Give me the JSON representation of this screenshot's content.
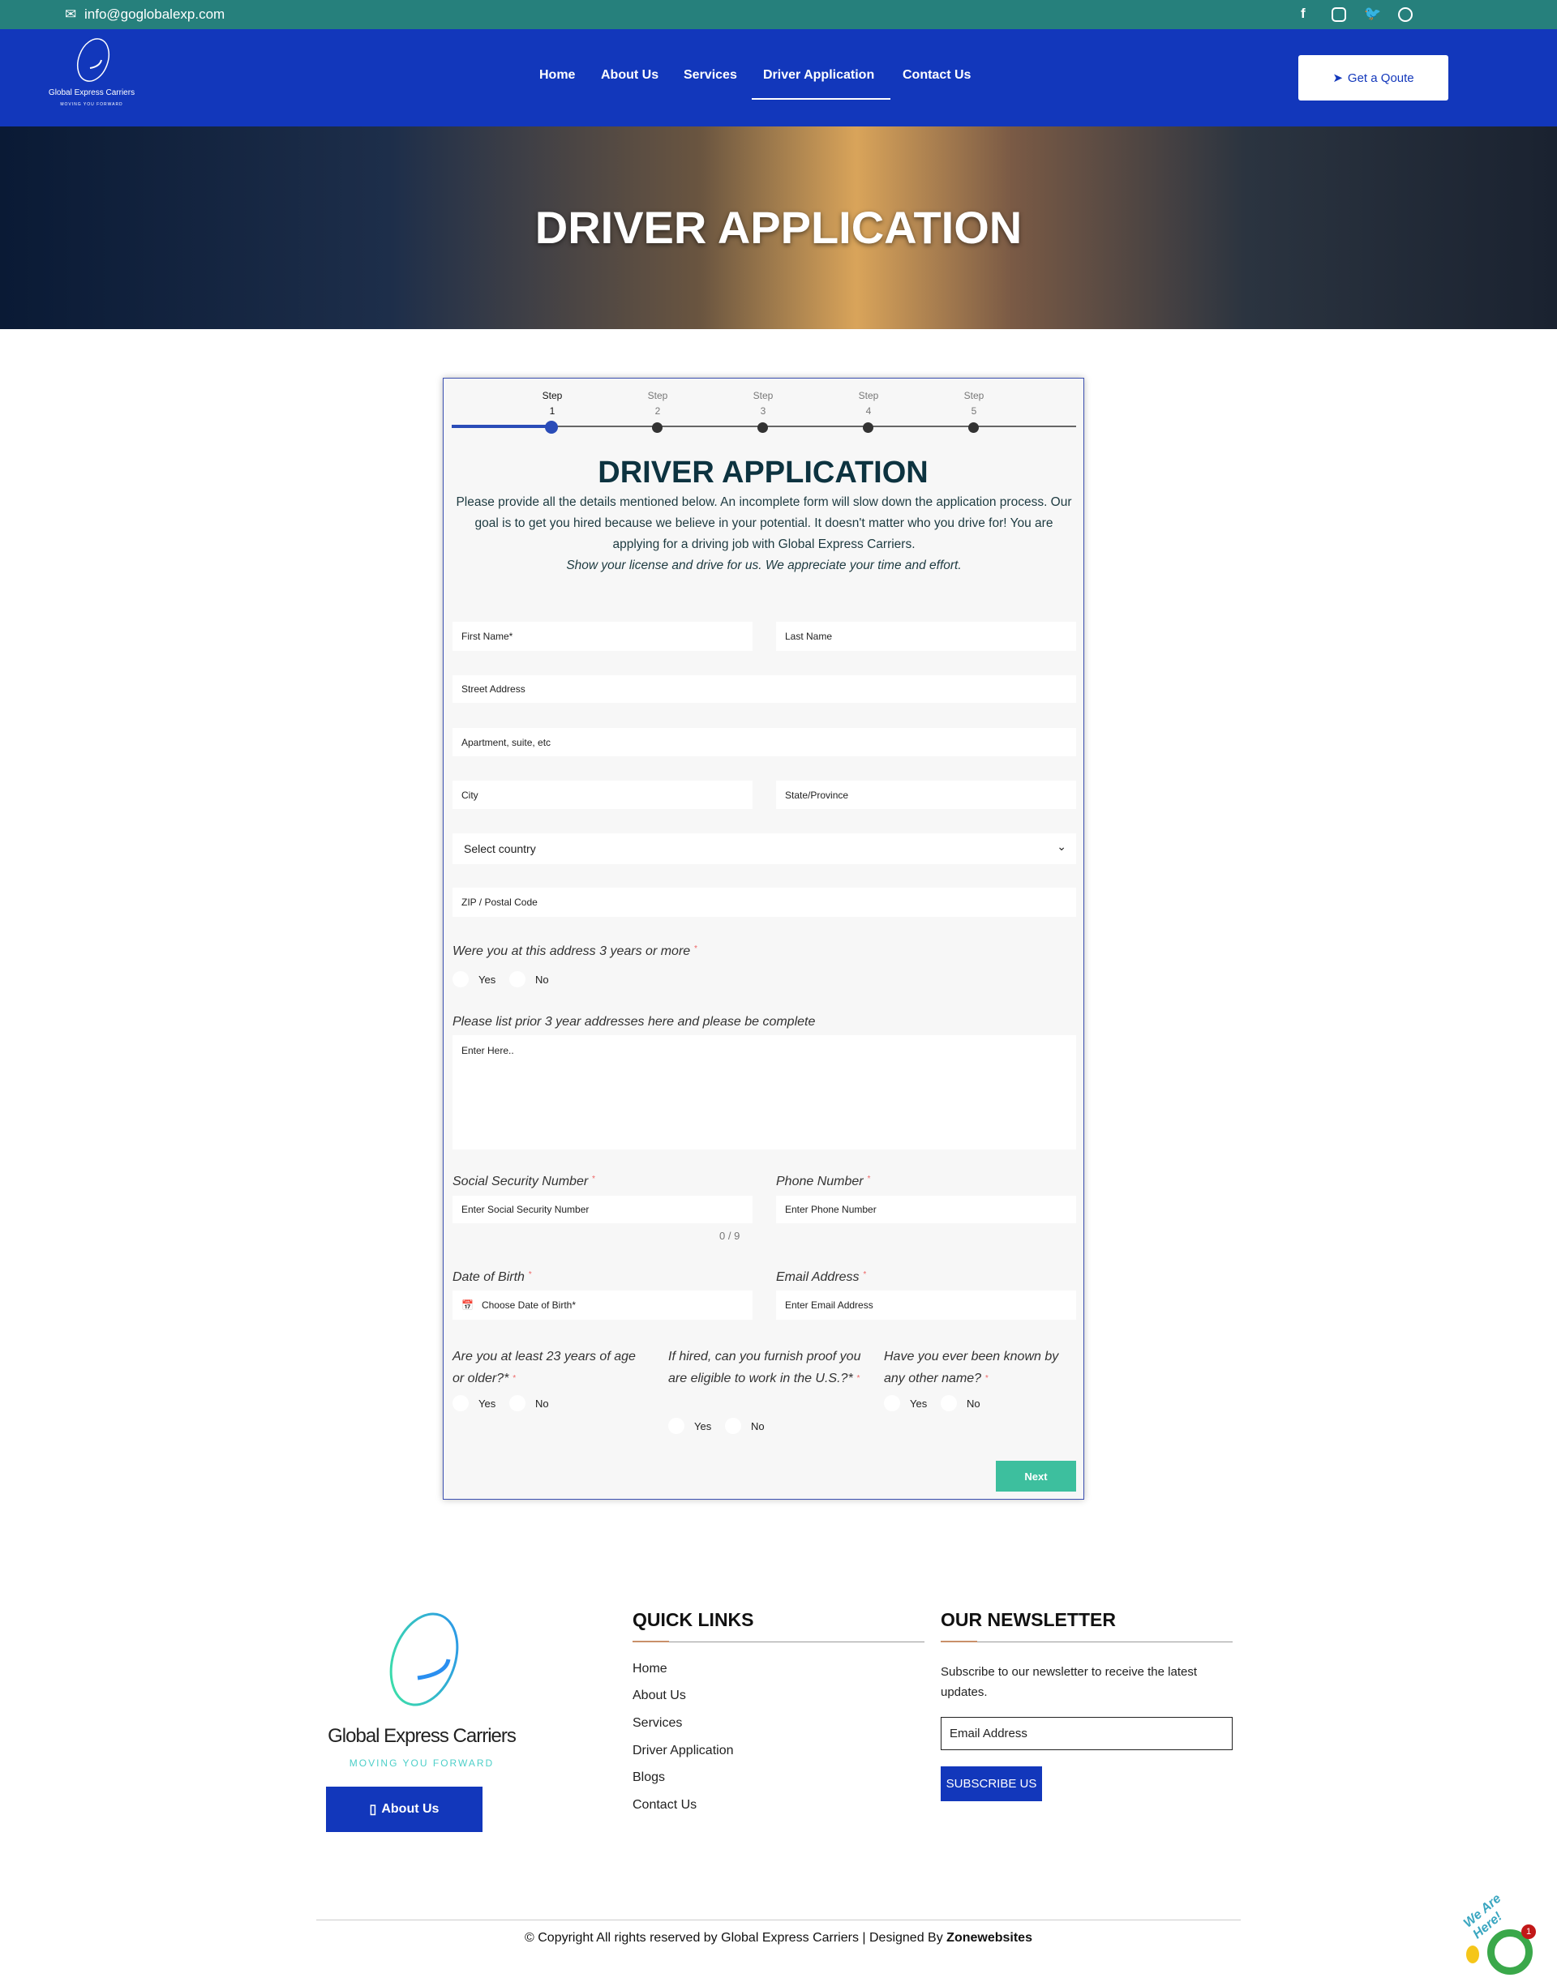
{
  "topbar": {
    "email": "info@goglobalexp.com",
    "social_icons": [
      "facebook-icon",
      "instagram-icon",
      "twitter-icon",
      "dribbble-icon"
    ]
  },
  "brand": {
    "name": "Global Express Carriers",
    "tagline": "MOVING YOU FORWARD"
  },
  "nav": {
    "items": [
      "Home",
      "About Us",
      "Services",
      "Driver Application",
      "Contact Us"
    ],
    "active": "Driver Application",
    "cta": "Get a Qoute"
  },
  "hero": {
    "title": "DRIVER APPLICATION"
  },
  "form": {
    "steps": [
      {
        "label": "Step",
        "num": "1"
      },
      {
        "label": "Step",
        "num": "2"
      },
      {
        "label": "Step",
        "num": "3"
      },
      {
        "label": "Step",
        "num": "4"
      },
      {
        "label": "Step",
        "num": "5"
      }
    ],
    "current_step": 1,
    "title": "DRIVER APPLICATION",
    "intro": "Please provide all the details mentioned below. An incomplete form will slow down the application process. Our goal is to get you hired because we believe in your potential. It doesn't matter who you drive for! You are applying for a driving job with Global Express Carriers.",
    "intro_italic": "Show your license and drive for us. We appreciate your time and effort.",
    "first_name": "First Name*",
    "last_name": "Last Name",
    "street": "Street Address",
    "apt": "Apartment, suite, etc",
    "city": "City",
    "state": "State/Province",
    "country": "Select country",
    "zip": "ZIP / Postal Code",
    "q_address": "Were you at this address 3 years or more",
    "yes": "Yes",
    "no": "No",
    "prior_label": "Please list prior 3 year addresses here and please be complete",
    "prior_placeholder": "Enter Here..",
    "ssn_label": "Social Security Number",
    "ssn_placeholder": "Enter Social Security Number",
    "ssn_counter": "0 / 9",
    "phone_label": "Phone Number",
    "phone_placeholder": "Enter Phone Number",
    "dob_label": "Date of Birth",
    "dob_placeholder": "Choose Date of Birth*",
    "email_label": "Email Address",
    "email_placeholder": "Enter Email Address",
    "q_age": "Are you at least 23 years of age or older?*",
    "q_eligible": "If hired, can you furnish proof you are eligible to work in the U.S.?*",
    "q_other_name": "Have you ever been known by any other name?",
    "next": "Next"
  },
  "footer": {
    "about_button": "About Us",
    "quick_links_title": "QUICK LINKS",
    "quick_links": [
      "Home",
      "About Us",
      "Services",
      "Driver Application",
      "Blogs",
      "Contact Us"
    ],
    "newsletter_title": "OUR NEWSLETTER",
    "newsletter_text": "Subscribe to our newsletter to receive the latest updates.",
    "newsletter_placeholder": "Email Address",
    "subscribe": "SUBSCRIBE US",
    "copyright": "© Copyright All rights reserved by Global Express Carriers | Designed By ",
    "designer": "Zonewebsites",
    "chat_text": "We Are Here!",
    "chat_badge": "1"
  },
  "colors": {
    "topbar": "#26807c",
    "nav": "#1237bb",
    "next": "#3dbf9e",
    "title": "#0d3340"
  }
}
